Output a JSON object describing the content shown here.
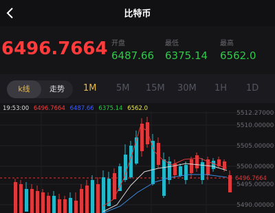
{
  "header": {
    "title": "比特币",
    "back_icon": "back-arrow-icon"
  },
  "quote": {
    "last_price": "6496.7664",
    "open_label": "开盘",
    "open_value": "6487.66",
    "low_label": "最低",
    "low_value": "6375.14",
    "high_label": "最高",
    "high_value": "6562.0"
  },
  "tabs": {
    "kline_label": "k线",
    "trend_label": "走势",
    "periods": [
      "1M",
      "5M",
      "15M",
      "30M",
      "1H",
      "1D"
    ],
    "active_period": "1M"
  },
  "legend": {
    "time": "19:53:00",
    "close": "6496.7664",
    "open": "6487.66",
    "low": "6375.14",
    "high": "6562.0"
  },
  "chart_data": {
    "type": "candlestick",
    "y_tick_labels": [
      "5512.27000",
      "5510.00000",
      "5505.00000",
      "5500.00000",
      "5495.00000",
      "5490.00000"
    ],
    "last_price_label": "6496.7664",
    "colors": {
      "up": "#23b8c9",
      "down": "#e0393b",
      "ma1": "#e0393b",
      "ma2": "#d8d8d8",
      "ma3": "#3a8de0"
    }
  }
}
